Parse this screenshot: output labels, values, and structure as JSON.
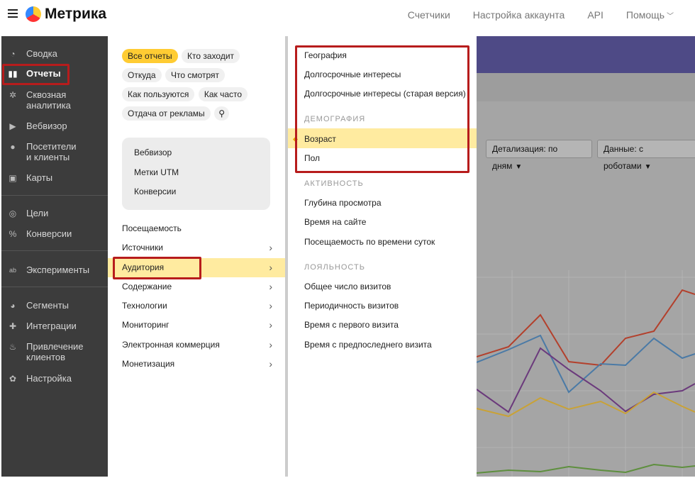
{
  "header": {
    "app_name": "Метрика",
    "nav": [
      "Счетчики",
      "Настройка аккаунта",
      "API",
      "Помощь"
    ]
  },
  "sidebar": {
    "items": [
      {
        "label": "Сводка",
        "icon": "dashboard-icon"
      },
      {
        "label": "Отчеты",
        "icon": "reports-icon"
      },
      {
        "label": "Сквозная аналитика",
        "icon": "end-to-end-analytics-icon"
      },
      {
        "label": "Вебвизор",
        "icon": "play-icon"
      },
      {
        "label": "Посетители и клиенты",
        "icon": "person-icon"
      },
      {
        "label": "Карты",
        "icon": "map-icon"
      },
      {
        "label": "Цели",
        "icon": "target-icon"
      },
      {
        "label": "Конверсии",
        "icon": "percent-icon"
      },
      {
        "label": "Эксперименты",
        "icon": "ab-icon"
      },
      {
        "label": "Сегменты",
        "icon": "pie-icon"
      },
      {
        "label": "Интеграции",
        "icon": "puzzle-icon"
      },
      {
        "label": "Привлечение клиентов",
        "icon": "flame-icon"
      },
      {
        "label": "Настройка",
        "icon": "gear-icon"
      }
    ]
  },
  "reports_menu": {
    "chips": [
      "Все отчеты",
      "Кто заходит",
      "Откуда",
      "Что смотрят",
      "Как пользуются",
      "Как часто",
      "Отдача от рекламы"
    ],
    "quick_links": [
      "Вебвизор",
      "Метки UTM",
      "Конверсии"
    ],
    "categories": [
      "Посещаемость",
      "Источники",
      "Аудитория",
      "Содержание",
      "Технологии",
      "Мониторинг",
      "Электронная коммерция",
      "Монетизация"
    ]
  },
  "submenu": {
    "items_top": [
      "География",
      "Долгосрочные интересы",
      "Долгосрочные интересы (старая версия)"
    ],
    "section_demography": "ДЕМОГРАФИЯ",
    "demography": [
      "Возраст",
      "Пол"
    ],
    "section_activity": "АКТИВНОСТЬ",
    "activity": [
      "Глубина просмотра",
      "Время на сайте",
      "Посещаемость по времени суток"
    ],
    "section_loyalty": "ЛОЯЛЬНОСТЬ",
    "loyalty": [
      "Общее число визитов",
      "Периодичность визитов",
      "Время с первого визита",
      "Время с предпоследнего визита"
    ]
  },
  "toolbar": {
    "detail_label": "Детализация: по дням",
    "data_label": "Данные: с роботами"
  },
  "colors": {
    "accent_yellow": "#ffcc33",
    "selection": "#ffeba0",
    "highlight_red": "#b71c1c",
    "sidebar_bg": "#3c3c3c",
    "header_band": "#4e4a86"
  }
}
